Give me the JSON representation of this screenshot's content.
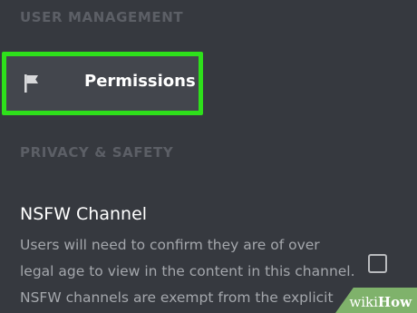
{
  "colors": {
    "background": "#36393f",
    "highlight": "#2ee01b",
    "item_background": "#43464d",
    "header_text": "#5c5f66",
    "body_text": "#a4a7ac",
    "watermark": "#7fb26b"
  },
  "sections": {
    "user_management": {
      "header": "USER MANAGEMENT"
    },
    "permissions_item": {
      "icon": "flag-icon",
      "label": "Permissions",
      "highlighted": true
    },
    "privacy_safety": {
      "header": "PRIVACY & SAFETY",
      "nsfw": {
        "title": "NSFW Channel",
        "description_lines": [
          "Users will need to confirm they are of over",
          "legal age to view in the content in this channel.",
          "NSFW channels are exempt from the explicit"
        ],
        "checked": false
      }
    }
  },
  "watermark": {
    "part1": "wiki",
    "part2": "How"
  }
}
